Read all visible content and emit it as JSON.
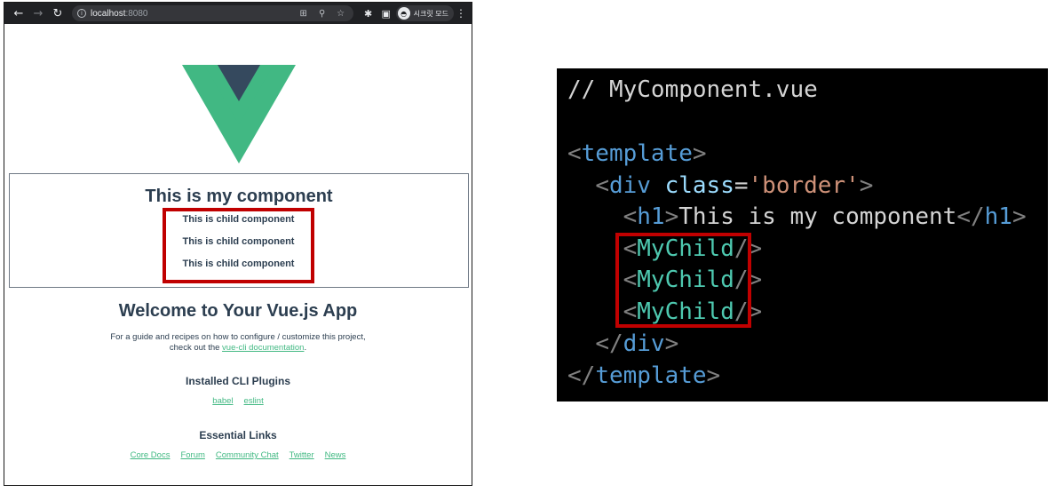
{
  "browser": {
    "url_host": "localhost",
    "url_port": ":8080",
    "profile_label": "시크릿 모드",
    "icons": [
      "back-arrow-icon",
      "forward-arrow-icon",
      "reload-icon",
      "info-icon",
      "translate-icon",
      "zoom-icon",
      "star-icon",
      "extensions-puzzle-icon",
      "sidebar-icon",
      "incognito-icon",
      "more-menu-icon"
    ]
  },
  "app": {
    "logo": "vue-logo",
    "my_component_title": "This is my component",
    "child_items": [
      "This is child component",
      "This is child component",
      "This is child component"
    ],
    "welcome_title": "Welcome to Your Vue.js App",
    "guide_line1": "For a guide and recipes on how to configure / customize this project,",
    "guide_line2_pre": "check out the ",
    "guide_link": "vue-cli documentation",
    "guide_line2_post": ".",
    "plugins_title": "Installed CLI Plugins",
    "plugins": [
      "babel",
      "eslint"
    ],
    "links_title": "Essential Links",
    "links": [
      "Core Docs",
      "Forum",
      "Community Chat",
      "Twitter",
      "News"
    ]
  },
  "code": {
    "comment": "// MyComponent.vue",
    "open_template": "template",
    "div_tag": "div",
    "class_attr": "class",
    "class_value": "'border'",
    "h1_tag": "h1",
    "h1_text": "This is my component",
    "child_tag": "MyChild",
    "close_div": "div",
    "close_template": "template"
  },
  "colors": {
    "highlight": "#c00000",
    "vue_green": "#42b983",
    "vue_dark": "#35495e",
    "text": "#2c3e50"
  }
}
